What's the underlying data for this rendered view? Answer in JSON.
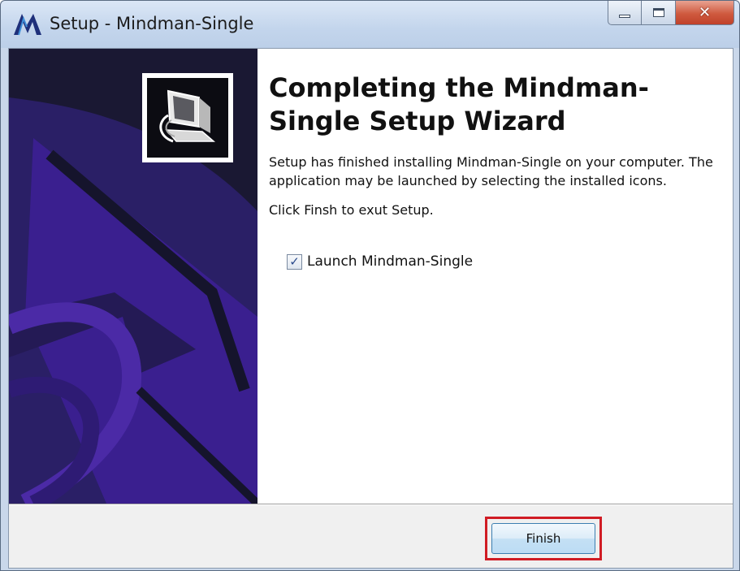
{
  "window": {
    "title": "Setup - Mindman-Single",
    "close_glyph": "✕"
  },
  "icons": {
    "app": "mindman-logo-icon",
    "banner": "computer-install-icon",
    "minimize": "minimize-icon",
    "maximize": "maximize-icon",
    "close": "close-icon"
  },
  "colors": {
    "banner_bg": "#1a1833",
    "banner_accent": "#3a1f8f",
    "highlight": "#d01c24"
  },
  "wizard": {
    "heading": "Completing the Mindman-Single Setup Wizard",
    "paragraph1": "Setup has finished installing Mindman-Single on your computer. The application may be launched by selecting the installed icons.",
    "paragraph2": "Click Finsh to exut Setup.",
    "launch_label": "Launch Mindman-Single",
    "launch_checked": true,
    "check_glyph": "✓"
  },
  "footer": {
    "finish_label": "Finish"
  }
}
